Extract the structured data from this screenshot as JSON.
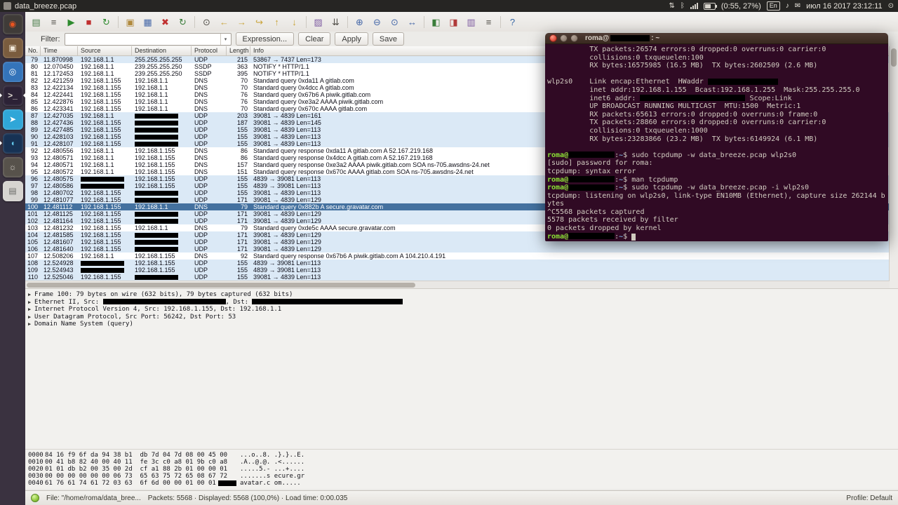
{
  "icons": {
    "sync": "⇅",
    "bluetooth": "ᛒ",
    "volume": "♪",
    "messages": "✉",
    "power": "⊙",
    "combo_arrow": "▾",
    "detail_arrow": "▶"
  },
  "topbar": {
    "title": "data_breeze.pcap",
    "battery_label": "(0:55, 27%)",
    "keyboard_layout": "En",
    "clock": "июл 16 2017 23:12:11"
  },
  "launcher": {
    "items": [
      {
        "name": "dash-home",
        "glyph": "◉",
        "bg": "#3f3b38",
        "fg": "#e95420"
      },
      {
        "name": "files",
        "glyph": "▣",
        "bg": "#7a5c3e",
        "fg": "#f0e6d6"
      },
      {
        "name": "browser",
        "glyph": "◎",
        "bg": "#3474ba",
        "fg": "#ffffff"
      },
      {
        "name": "terminal",
        "glyph": ">_",
        "bg": "#2c2236",
        "fg": "#d9d4cc",
        "running": true,
        "focused": true
      },
      {
        "name": "telegram",
        "glyph": "➤",
        "bg": "#2fa6d8",
        "fg": "#ffffff"
      },
      {
        "name": "wireshark",
        "glyph": "◖",
        "bg": "#173254",
        "fg": "#63c7ea",
        "running": true
      },
      {
        "name": "system-settings",
        "glyph": "☼",
        "bg": "#57524b",
        "fg": "#dcd8d1"
      },
      {
        "name": "text-editor",
        "glyph": "▤",
        "bg": "#d6d4d0",
        "fg": "#6b6b68"
      }
    ]
  },
  "wireshark": {
    "toolbar": [
      {
        "name": "list-interfaces",
        "glyph": "▤",
        "color": "#4a7d4a"
      },
      {
        "name": "capture-options",
        "glyph": "≡",
        "color": "#55524c"
      },
      {
        "name": "start-capture",
        "glyph": "▶",
        "color": "#2e8b2e"
      },
      {
        "name": "stop-capture",
        "glyph": "■",
        "color": "#c03030"
      },
      {
        "name": "restart-capture",
        "glyph": "↻",
        "color": "#2e8b2e"
      },
      {
        "sep": true
      },
      {
        "name": "open-file",
        "glyph": "▣",
        "color": "#b08a3e"
      },
      {
        "name": "save-file",
        "glyph": "▦",
        "color": "#4668a8"
      },
      {
        "name": "close-file",
        "glyph": "✖",
        "color": "#c03030"
      },
      {
        "name": "reload-file",
        "glyph": "↻",
        "color": "#3a7d3a"
      },
      {
        "sep": true
      },
      {
        "name": "find-packet",
        "glyph": "⊙",
        "color": "#55524c"
      },
      {
        "name": "go-back",
        "glyph": "←",
        "color": "#caa53c"
      },
      {
        "name": "go-forward",
        "glyph": "→",
        "color": "#caa53c"
      },
      {
        "name": "go-to-packet",
        "glyph": "↪",
        "color": "#caa53c"
      },
      {
        "name": "go-first",
        "glyph": "↑",
        "color": "#caa53c"
      },
      {
        "name": "go-last",
        "glyph": "↓",
        "color": "#caa53c"
      },
      {
        "sep": true
      },
      {
        "name": "colorize",
        "glyph": "▨",
        "color": "#7d5aa0"
      },
      {
        "name": "auto-scroll",
        "glyph": "⇊",
        "color": "#55524c"
      },
      {
        "sep": true
      },
      {
        "name": "zoom-in",
        "glyph": "⊕",
        "color": "#4668a8"
      },
      {
        "name": "zoom-out",
        "glyph": "⊖",
        "color": "#4668a8"
      },
      {
        "name": "zoom-normal",
        "glyph": "⊙",
        "color": "#4668a8"
      },
      {
        "name": "resize-columns",
        "glyph": "↔",
        "color": "#4668a8"
      },
      {
        "sep": true
      },
      {
        "name": "capture-filters",
        "glyph": "◧",
        "color": "#3a7d3a"
      },
      {
        "name": "display-filters",
        "glyph": "◨",
        "color": "#b03a3a"
      },
      {
        "name": "coloring-rules",
        "glyph": "▥",
        "color": "#7d5aa0"
      },
      {
        "name": "preferences",
        "glyph": "≡",
        "color": "#55524c"
      },
      {
        "sep": true
      },
      {
        "name": "help",
        "glyph": "?",
        "color": "#3465a4"
      }
    ],
    "filter": {
      "label": "Filter:",
      "value": "",
      "expression_button": "Expression...",
      "clear_button": "Clear",
      "apply_button": "Apply",
      "save_button": "Save"
    },
    "columns": [
      "No.",
      "Time",
      "Source",
      "Destination",
      "Protocol",
      "Length",
      "Info"
    ],
    "packets": [
      {
        "no": 79,
        "time": "11.870998",
        "src": "192.168.1.1",
        "dst": "255.255.255.255",
        "proto": "UDP",
        "len": "215",
        "info": "53867 → 7437 Len=173",
        "cls": "udp"
      },
      {
        "no": 80,
        "time": "12.070450",
        "src": "192.168.1.1",
        "dst": "239.255.255.250",
        "proto": "SSDP",
        "len": "363",
        "info": "NOTIFY * HTTP/1.1",
        "cls": "ssdp"
      },
      {
        "no": 81,
        "time": "12.172453",
        "src": "192.168.1.1",
        "dst": "239.255.255.250",
        "proto": "SSDP",
        "len": "395",
        "info": "NOTIFY * HTTP/1.1",
        "cls": "ssdp"
      },
      {
        "no": 82,
        "time": "12.421259",
        "src": "192.168.1.155",
        "dst": "192.168.1.1",
        "proto": "DNS",
        "len": "70",
        "info": "Standard query 0xda11 A gitlab.com",
        "cls": "dns"
      },
      {
        "no": 83,
        "time": "12.422134",
        "src": "192.168.1.155",
        "dst": "192.168.1.1",
        "proto": "DNS",
        "len": "70",
        "info": "Standard query 0x4dcc A gitlab.com",
        "cls": "dns"
      },
      {
        "no": 84,
        "time": "12.422441",
        "src": "192.168.1.155",
        "dst": "192.168.1.1",
        "proto": "DNS",
        "len": "76",
        "info": "Standard query 0x67b6 A piwik.gitlab.com",
        "cls": "dns"
      },
      {
        "no": 85,
        "time": "12.422876",
        "src": "192.168.1.155",
        "dst": "192.168.1.1",
        "proto": "DNS",
        "len": "76",
        "info": "Standard query 0xe3a2 AAAA piwik.gitlab.com",
        "cls": "dns"
      },
      {
        "no": 86,
        "time": "12.423341",
        "src": "192.168.1.155",
        "dst": "192.168.1.1",
        "proto": "DNS",
        "len": "70",
        "info": "Standard query 0x670c AAAA gitlab.com",
        "cls": "dns"
      },
      {
        "no": 87,
        "time": "12.427035",
        "src": "192.168.1.1",
        "dst": "[R]",
        "proto": "UDP",
        "len": "203",
        "info": "39081 → 4839 Len=161",
        "cls": "udp"
      },
      {
        "no": 88,
        "time": "12.427436",
        "src": "192.168.1.155",
        "dst": "[R]",
        "proto": "UDP",
        "len": "187",
        "info": "39081 → 4839 Len=145",
        "cls": "udp"
      },
      {
        "no": 89,
        "time": "12.427485",
        "src": "192.168.1.155",
        "dst": "[R]",
        "proto": "UDP",
        "len": "155",
        "info": "39081 → 4839 Len=113",
        "cls": "udp"
      },
      {
        "no": 90,
        "time": "12.428103",
        "src": "192.168.1.155",
        "dst": "[R]",
        "proto": "UDP",
        "len": "155",
        "info": "39081 → 4839 Len=113",
        "cls": "udp"
      },
      {
        "no": 91,
        "time": "12.428107",
        "src": "192.168.1.155",
        "dst": "[R]",
        "proto": "UDP",
        "len": "155",
        "info": "39081 → 4839 Len=113",
        "cls": "udp"
      },
      {
        "no": 92,
        "time": "12.480556",
        "src": "192.168.1.1",
        "dst": "192.168.1.155",
        "proto": "DNS",
        "len": "86",
        "info": "Standard query response 0xda11 A gitlab.com A 52.167.219.168",
        "cls": "dns"
      },
      {
        "no": 93,
        "time": "12.480571",
        "src": "192.168.1.1",
        "dst": "192.168.1.155",
        "proto": "DNS",
        "len": "86",
        "info": "Standard query response 0x4dcc A gitlab.com A 52.167.219.168",
        "cls": "dns"
      },
      {
        "no": 94,
        "time": "12.480571",
        "src": "192.168.1.1",
        "dst": "192.168.1.155",
        "proto": "DNS",
        "len": "157",
        "info": "Standard query response 0xe3a2 AAAA piwik.gitlab.com SOA ns-705.awsdns-24.net",
        "cls": "dns"
      },
      {
        "no": 95,
        "time": "12.480572",
        "src": "192.168.1.1",
        "dst": "192.168.1.155",
        "proto": "DNS",
        "len": "151",
        "info": "Standard query response 0x670c AAAA gitlab.com SOA ns-705.awsdns-24.net",
        "cls": "dns"
      },
      {
        "no": 96,
        "time": "12.480575",
        "src": "[R]",
        "dst": "192.168.1.155",
        "proto": "UDP",
        "len": "155",
        "info": "4839 → 39081 Len=113",
        "cls": "udp"
      },
      {
        "no": 97,
        "time": "12.480586",
        "src": "[R]",
        "dst": "192.168.1.155",
        "proto": "UDP",
        "len": "155",
        "info": "4839 → 39081 Len=113",
        "cls": "udp"
      },
      {
        "no": 98,
        "time": "12.480702",
        "src": "192.168.1.155",
        "dst": "[R]",
        "proto": "UDP",
        "len": "155",
        "info": "39081 → 4839 Len=113",
        "cls": "udp"
      },
      {
        "no": 99,
        "time": "12.481077",
        "src": "192.168.1.155",
        "dst": "[R]",
        "proto": "UDP",
        "len": "171",
        "info": "39081 → 4839 Len=129",
        "cls": "udp"
      },
      {
        "no": 100,
        "time": "12.481112",
        "src": "192.168.1.155",
        "dst": "192.168.1.1",
        "proto": "DNS",
        "len": "79",
        "info": "Standard query 0x882b A secure.gravatar.com",
        "cls": "dns",
        "sel": true
      },
      {
        "no": 101,
        "time": "12.481125",
        "src": "192.168.1.155",
        "dst": "[R]",
        "proto": "UDP",
        "len": "171",
        "info": "39081 → 4839 Len=129",
        "cls": "udp"
      },
      {
        "no": 102,
        "time": "12.481164",
        "src": "192.168.1.155",
        "dst": "[R]",
        "proto": "UDP",
        "len": "171",
        "info": "39081 → 4839 Len=129",
        "cls": "udp"
      },
      {
        "no": 103,
        "time": "12.481232",
        "src": "192.168.1.155",
        "dst": "192.168.1.1",
        "proto": "DNS",
        "len": "79",
        "info": "Standard query 0xde5c AAAA secure.gravatar.com",
        "cls": "dns"
      },
      {
        "no": 104,
        "time": "12.481585",
        "src": "192.168.1.155",
        "dst": "[R]",
        "proto": "UDP",
        "len": "171",
        "info": "39081 → 4839 Len=129",
        "cls": "udp"
      },
      {
        "no": 105,
        "time": "12.481607",
        "src": "192.168.1.155",
        "dst": "[R]",
        "proto": "UDP",
        "len": "171",
        "info": "39081 → 4839 Len=129",
        "cls": "udp"
      },
      {
        "no": 106,
        "time": "12.481640",
        "src": "192.168.1.155",
        "dst": "[R]",
        "proto": "UDP",
        "len": "171",
        "info": "39081 → 4839 Len=129",
        "cls": "udp"
      },
      {
        "no": 107,
        "time": "12.508206",
        "src": "192.168.1.1",
        "dst": "192.168.1.155",
        "proto": "DNS",
        "len": "92",
        "info": "Standard query response 0x67b6 A piwik.gitlab.com A 104.210.4.191",
        "cls": "dns"
      },
      {
        "no": 108,
        "time": "12.524928",
        "src": "[R]",
        "dst": "192.168.1.155",
        "proto": "UDP",
        "len": "155",
        "info": "4839 → 39081 Len=113",
        "cls": "udp"
      },
      {
        "no": 109,
        "time": "12.524943",
        "src": "[R]",
        "dst": "192.168.1.155",
        "proto": "UDP",
        "len": "155",
        "info": "4839 → 39081 Len=113",
        "cls": "udp"
      },
      {
        "no": 110,
        "time": "12.525046",
        "src": "192.168.1.155",
        "dst": "[R]",
        "proto": "UDP",
        "len": "155",
        "info": "39081 → 4839 Len=113",
        "cls": "udp"
      }
    ],
    "details": [
      {
        "segs": [
          [
            "t",
            "Frame 100: 79 bytes on wire (632 bits), 79 bytes captured (632 bits)"
          ]
        ]
      },
      {
        "segs": [
          [
            "t",
            "Ethernet II, Src: "
          ],
          [
            "R",
            175
          ],
          [
            "t",
            ", Dst: "
          ],
          [
            "R",
            215
          ]
        ]
      },
      {
        "segs": [
          [
            "t",
            "Internet Protocol Version 4, Src: 192.168.1.155, Dst: 192.168.1.1"
          ]
        ]
      },
      {
        "segs": [
          [
            "t",
            "User Datagram Protocol, Src Port: 56242, Dst Port: 53"
          ]
        ]
      },
      {
        "segs": [
          [
            "t",
            "Domain Name System (query)"
          ]
        ]
      }
    ],
    "hexdump": [
      {
        "off": "0000",
        "hex": "84 16 f9 6f da 94 38 b1  db 7d 04 7d 08 00 45 00",
        "ascii": "...o..8. .}.}..E."
      },
      {
        "off": "0010",
        "hex": "00 41 b8 82 40 00 40 11  fe 3c c0 a8 01 9b c0 a8",
        "ascii": ".A..@.@. .<......"
      },
      {
        "off": "0020",
        "hex": "01 01 db b2 00 35 00 2d  cf a1 88 2b 01 00 00 01",
        "ascii": ".....5.- ...+...."
      },
      {
        "off": "0030",
        "hex": "00 00 00 00 00 00 06 73  65 63 75 72 65 08 67 72",
        "ascii": ".......s ecure.gr"
      },
      {
        "off": "0040",
        "hex": "61 76 61 74 61 72 03 63  6f 6d 00 00 01 00 01",
        "ascii": "avatar.c om.....",
        "redact": true
      }
    ],
    "status": {
      "file": "File: \"/home/roma/data_bree...",
      "summary": "Packets: 5568 · Displayed: 5568 (100,0%) · Load time: 0:00.035",
      "profile": "Profile: Default"
    }
  },
  "terminal": {
    "title_user": "roma@",
    "title_path": ": ~",
    "lines": [
      [
        [
          "t",
          "          TX packets:26574 errors:0 dropped:0 overruns:0 carrier:0"
        ]
      ],
      [
        [
          "t",
          "          collisions:0 txqueuelen:100"
        ]
      ],
      [
        [
          "t",
          "          RX bytes:16575985 (16.5 MB)  TX bytes:2602509 (2.6 MB)"
        ]
      ],
      [],
      [
        [
          "t",
          "wlp2s0    Link encap:Ethernet  HWaddr "
        ],
        [
          "R",
          100
        ]
      ],
      [
        [
          "t",
          "          inet addr:192.168.1.155  Bcast:192.168.1.255  Mask:255.255.255.0"
        ]
      ],
      [
        [
          "t",
          "          inet6 addr: "
        ],
        [
          "R",
          150
        ],
        [
          "t",
          " Scope:Link"
        ]
      ],
      [
        [
          "t",
          "          UP BROADCAST RUNNING MULTICAST  MTU:1500  Metric:1"
        ]
      ],
      [
        [
          "t",
          "          RX packets:65613 errors:0 dropped:0 overruns:0 frame:0"
        ]
      ],
      [
        [
          "t",
          "          TX packets:28860 errors:0 dropped:0 overruns:0 carrier:0"
        ]
      ],
      [
        [
          "t",
          "          collisions:0 txqueuelen:1000"
        ]
      ],
      [
        [
          "t",
          "          RX bytes:23283866 (23.2 MB)  TX bytes:6149924 (6.1 MB)"
        ]
      ],
      [],
      [
        [
          "g",
          "roma@"
        ],
        [
          "R",
          66
        ],
        [
          "t",
          ":"
        ],
        [
          "b",
          "~"
        ],
        [
          "t",
          "$ sudo tcpdump -w data_breeze.pcap wlp2s0"
        ]
      ],
      [
        [
          "t",
          "[sudo] password for roma:"
        ]
      ],
      [
        [
          "t",
          "tcpdump: syntax error"
        ]
      ],
      [
        [
          "g",
          "roma@"
        ],
        [
          "R",
          66
        ],
        [
          "t",
          ":"
        ],
        [
          "b",
          "~"
        ],
        [
          "t",
          "$ man tcpdump"
        ]
      ],
      [
        [
          "g",
          "roma@"
        ],
        [
          "R",
          66
        ],
        [
          "t",
          ":"
        ],
        [
          "b",
          "~"
        ],
        [
          "t",
          "$ sudo tcpdump -w data_breeze.pcap -i wlp2s0"
        ]
      ],
      [
        [
          "t",
          "tcpdump: listening on wlp2s0, link-type EN10MB (Ethernet), capture size 262144 b"
        ]
      ],
      [
        [
          "t",
          "ytes"
        ]
      ],
      [
        [
          "t",
          "^C5568 packets captured"
        ]
      ],
      [
        [
          "t",
          "5578 packets received by filter"
        ]
      ],
      [
        [
          "t",
          "0 packets dropped by kernel"
        ]
      ],
      [
        [
          "g",
          "roma@"
        ],
        [
          "R",
          66
        ],
        [
          "t",
          ":"
        ],
        [
          "b",
          "~"
        ],
        [
          "t",
          "$ "
        ],
        [
          "cur",
          ""
        ]
      ]
    ]
  }
}
